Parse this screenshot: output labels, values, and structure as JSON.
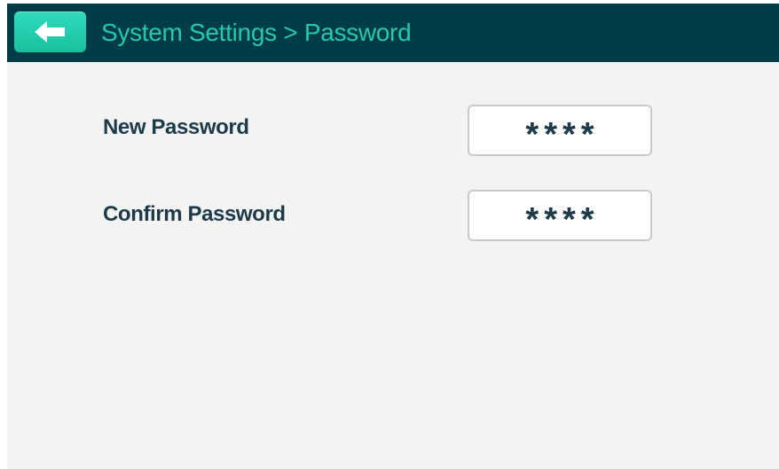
{
  "header": {
    "back_icon": "arrow-left-icon",
    "title": "System Settings > Password"
  },
  "form": {
    "new_password": {
      "label": "New Password",
      "value": "****"
    },
    "confirm_password": {
      "label": "Confirm Password",
      "value": "****"
    }
  },
  "colors": {
    "header_bg": "#013d48",
    "accent": "#26c8aa",
    "back_button": "#1fcca9",
    "background": "#f3f3f3",
    "text": "#1c3a4a"
  }
}
